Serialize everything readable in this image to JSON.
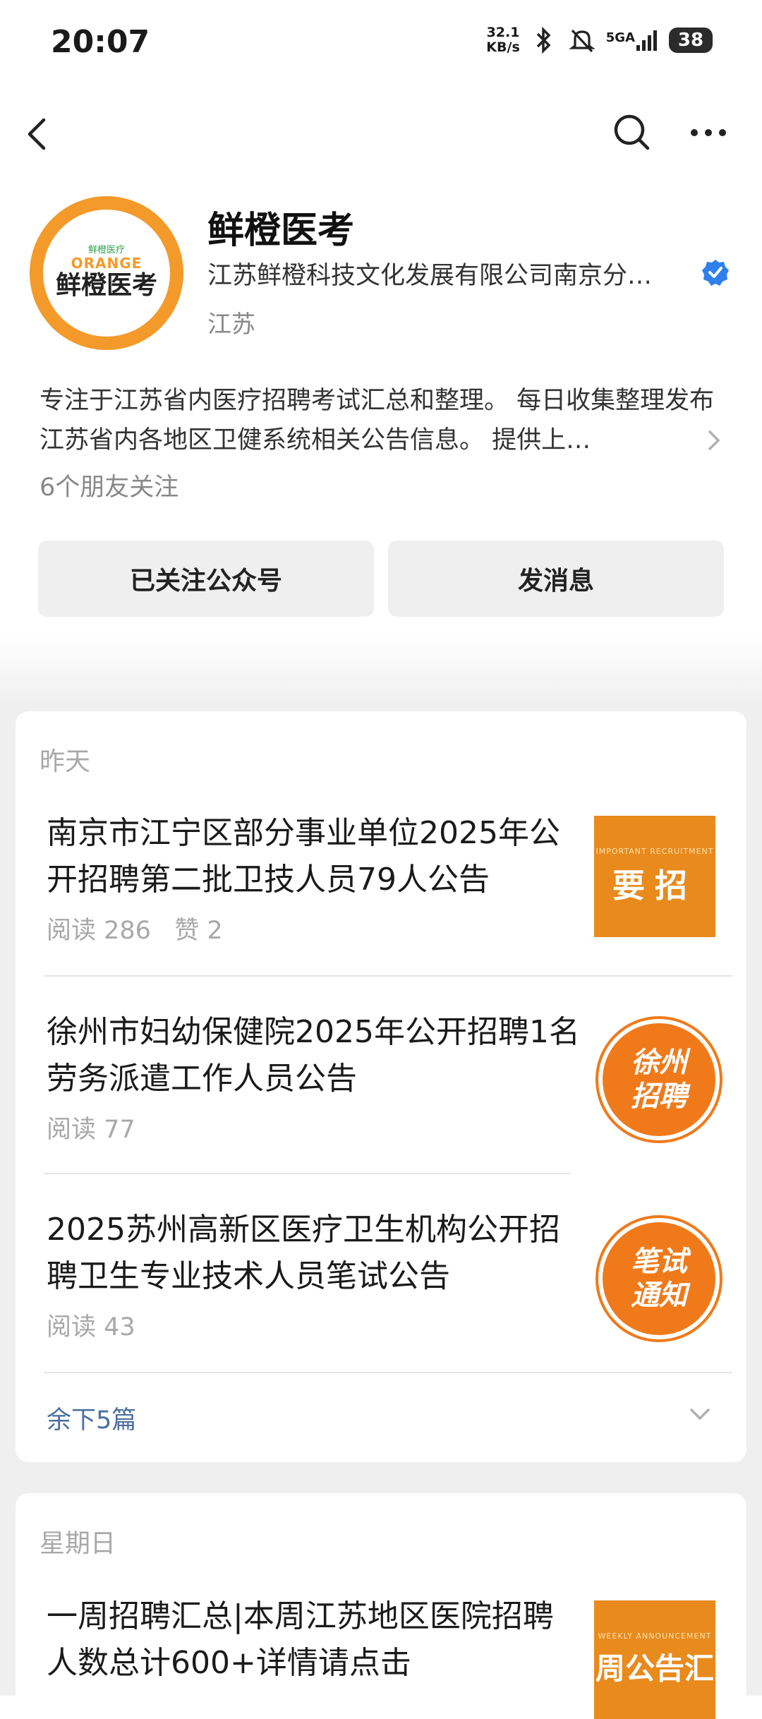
{
  "status_bar": {
    "time": "20:07",
    "net_speed_value": "32.1",
    "net_speed_unit": "KB/s",
    "signal_label": "5GA",
    "battery": "38"
  },
  "nav": {
    "back_icon": "chevron-left-icon",
    "search_icon": "search-icon",
    "more_icon": "more-icon"
  },
  "profile": {
    "avatar_small": "鲜橙医疗",
    "avatar_brand": "ORANGE",
    "avatar_text": "鲜橙医考",
    "name": "鲜橙医考",
    "company": "江苏鲜橙科技文化发展有限公司南京分…",
    "region": "江苏",
    "description": "专注于江苏省内医疗招聘考试汇总和整理。 每日收集整理发布江苏省内各地区卫健系统相关公告信息。 提供上…",
    "friends": "6个朋友关注",
    "follow_button": "已关注公众号",
    "message_button": "发消息"
  },
  "feed": [
    {
      "day": "昨天",
      "articles": [
        {
          "title": "南京市江宁区部分事业单位2025年公开招聘第二批卫技人员79人公告",
          "meta": "阅读 286   赞 2",
          "thumb_sub": "IMPORTANT RECRUITMENT",
          "thumb_text": "要招"
        },
        {
          "title": "徐州市妇幼保健院2025年公开招聘1名劳务派遣工作人员公告",
          "meta": "阅读 77",
          "thumb_line1": "徐州",
          "thumb_line2": "招聘"
        },
        {
          "title": "2025苏州高新区医疗卫生机构公开招聘卫生专业技术人员笔试公告",
          "meta": "阅读 43",
          "thumb_line1": "笔试",
          "thumb_line2": "通知"
        }
      ],
      "more": "余下5篇"
    },
    {
      "day": "星期日",
      "articles": [
        {
          "title": "一周招聘汇总|本周江苏地区医院招聘人数总计600+详情请点击",
          "thumb_sub": "WEEKLY ANNOUNCEMENT",
          "thumb_text": "周公告汇"
        }
      ]
    }
  ],
  "colors": {
    "brand_orange": "#f39a2a",
    "verified_blue": "#2f80ed",
    "link_blue": "#4a6fa0"
  }
}
